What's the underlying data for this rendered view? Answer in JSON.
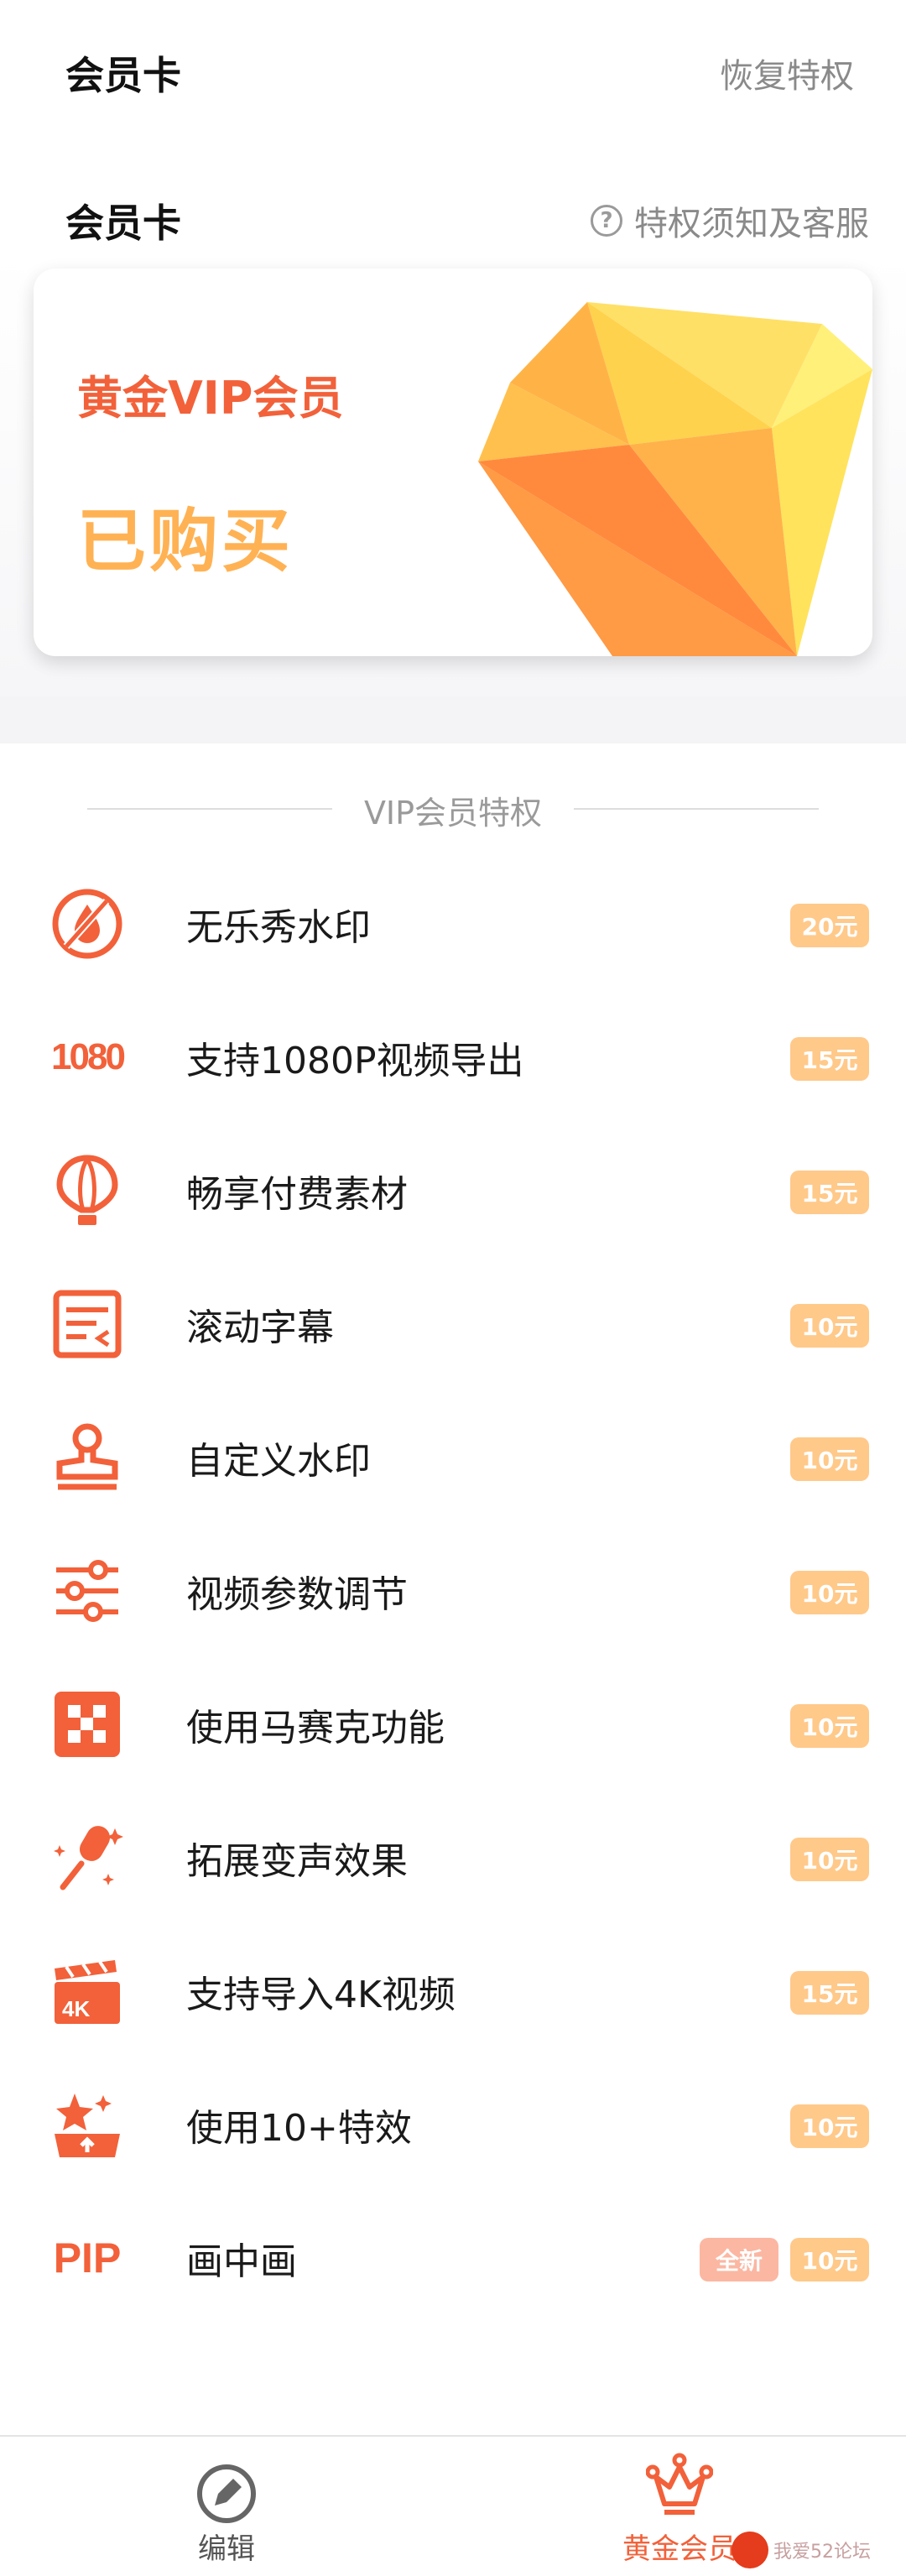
{
  "header": {
    "title": "会员卡",
    "restore_label": "恢复特权"
  },
  "section": {
    "title": "会员卡",
    "help_glyph": "?",
    "help_label": "特权须知及客服"
  },
  "card": {
    "name": "黄金VIP会员",
    "status": "已购买",
    "colors": {
      "name": "#f2613a",
      "status": "#ffb254"
    }
  },
  "privileges": {
    "title": "VIP会员特权",
    "items": [
      {
        "icon": "no-watermark-icon",
        "label": "无乐秀水印",
        "price": "20元"
      },
      {
        "icon": "1080-icon",
        "label": "支持1080P视频导出",
        "price": "15元",
        "icon_text": "1080"
      },
      {
        "icon": "balloon-icon",
        "label": "畅享付费素材",
        "price": "15元"
      },
      {
        "icon": "subtitle-scroll-icon",
        "label": "滚动字幕",
        "price": "10元"
      },
      {
        "icon": "stamp-icon",
        "label": "自定义水印",
        "price": "10元"
      },
      {
        "icon": "sliders-icon",
        "label": "视频参数调节",
        "price": "10元"
      },
      {
        "icon": "mosaic-icon",
        "label": "使用马赛克功能",
        "price": "10元"
      },
      {
        "icon": "microphone-icon",
        "label": "拓展变声效果",
        "price": "10元"
      },
      {
        "icon": "clapperboard-4k-icon",
        "label": "支持导入4K视频",
        "price": "15元",
        "icon_text": "4K"
      },
      {
        "icon": "effects-icon",
        "label": "使用10+特效",
        "price": "10元"
      },
      {
        "icon": "pip-icon",
        "label": "画中画",
        "price": "10元",
        "badge": "全新",
        "icon_text": "PIP"
      }
    ]
  },
  "tabbar": {
    "edit_label": "编辑",
    "vip_label": "黄金会员"
  },
  "watermark": {
    "text": "我爱52论坛"
  },
  "colors": {
    "accent": "#f2613a",
    "price_badge": "#ffc98a",
    "new_badge": "#fbb7a2"
  }
}
